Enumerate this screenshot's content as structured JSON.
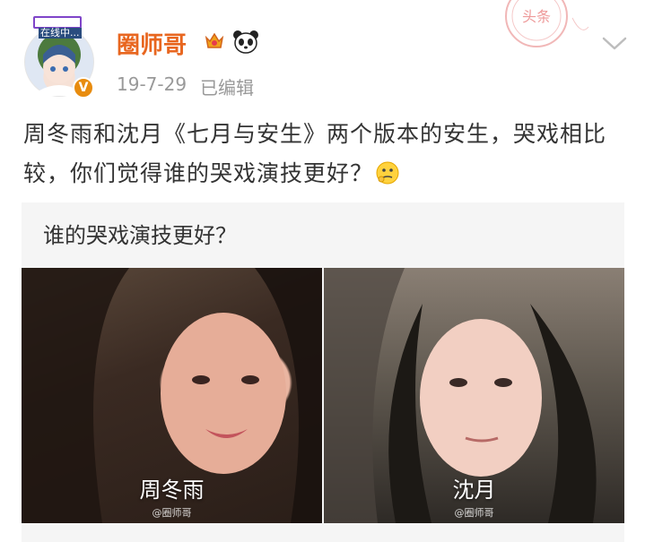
{
  "author": {
    "online_status": "在线中...",
    "name": "圈师哥",
    "verified_mark": "V",
    "badge_icons": [
      "crown-icon",
      "panda-icon"
    ]
  },
  "meta": {
    "date": "19-7-29",
    "edited_label": "已编辑"
  },
  "stamp_text": "头条",
  "post": {
    "text": "周冬雨和沈月《七月与安生》两个版本的安生，哭戏相比较，你们觉得谁的哭戏演技更好？",
    "trailing_emoji": "thinking-emoji"
  },
  "poll": {
    "question": "谁的哭戏演技更好？",
    "options": [
      {
        "label": "周冬雨",
        "watermark": "@圈师哥"
      },
      {
        "label": "沈月",
        "watermark": "@圈师哥"
      }
    ]
  },
  "colors": {
    "username": "#e8661f",
    "meta_text": "#999999",
    "card_bg": "#f5f5f5",
    "verified_badge": "#e88c0f"
  }
}
